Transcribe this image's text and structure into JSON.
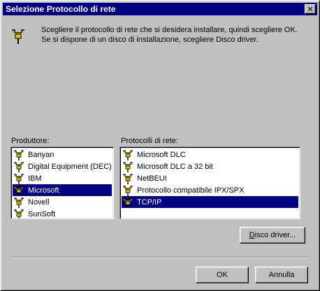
{
  "window": {
    "title": "Selezione Protocollo di rete",
    "close_icon": "close-icon"
  },
  "header": {
    "icon": "network-protocol-icon",
    "text": "Scegliere il protocollo di rete che si desidera installare, quindi scegliere OK. Se si dispone di un disco di installazione, scegliere Disco driver."
  },
  "manufacturers": {
    "label": "Produttore:",
    "items": [
      {
        "label": "Banyan",
        "selected": false
      },
      {
        "label": "Digital Equipment (DEC)",
        "selected": false
      },
      {
        "label": "IBM",
        "selected": false
      },
      {
        "label": "Microsoft",
        "selected": true
      },
      {
        "label": "Novell",
        "selected": false
      },
      {
        "label": "SunSoft",
        "selected": false
      }
    ]
  },
  "protocols": {
    "label": "Protocolli di rete:",
    "items": [
      {
        "label": "Microsoft DLC",
        "selected": false
      },
      {
        "label": "Microsoft DLC a 32 bit",
        "selected": false
      },
      {
        "label": "NetBEUI",
        "selected": false
      },
      {
        "label": "Protocollo compatibile IPX/SPX",
        "selected": false
      },
      {
        "label": "TCP/IP",
        "selected": true
      }
    ]
  },
  "buttons": {
    "disk_driver_first": "D",
    "disk_driver_rest": "isco driver...",
    "ok": "OK",
    "cancel": "Annulla"
  },
  "colors": {
    "face": "#c0c0c0",
    "title_bar": "#000080",
    "selection": "#000080"
  }
}
